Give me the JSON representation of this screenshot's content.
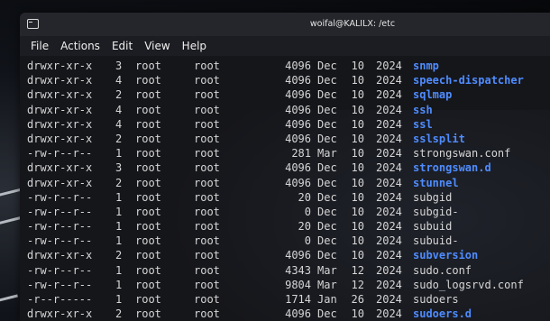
{
  "window": {
    "title": "woifal@KALILX: /etc",
    "icon": "terminal-icon"
  },
  "menu": [
    "File",
    "Actions",
    "Edit",
    "View",
    "Help"
  ],
  "colors": {
    "directory": "#4f8cff",
    "text": "#d6d6d6",
    "background": "#15161a"
  },
  "listing": [
    {
      "perm": "drwxr-xr-x",
      "links": "3",
      "owner": "root",
      "group": "root",
      "size": "4096",
      "month": "Dec",
      "day": "10",
      "year": "2024",
      "name": "snmp",
      "dir": true
    },
    {
      "perm": "drwxr-xr-x",
      "links": "4",
      "owner": "root",
      "group": "root",
      "size": "4096",
      "month": "Dec",
      "day": "10",
      "year": "2024",
      "name": "speech-dispatcher",
      "dir": true
    },
    {
      "perm": "drwxr-xr-x",
      "links": "2",
      "owner": "root",
      "group": "root",
      "size": "4096",
      "month": "Dec",
      "day": "10",
      "year": "2024",
      "name": "sqlmap",
      "dir": true
    },
    {
      "perm": "drwxr-xr-x",
      "links": "4",
      "owner": "root",
      "group": "root",
      "size": "4096",
      "month": "Dec",
      "day": "10",
      "year": "2024",
      "name": "ssh",
      "dir": true
    },
    {
      "perm": "drwxr-xr-x",
      "links": "4",
      "owner": "root",
      "group": "root",
      "size": "4096",
      "month": "Dec",
      "day": "10",
      "year": "2024",
      "name": "ssl",
      "dir": true
    },
    {
      "perm": "drwxr-xr-x",
      "links": "2",
      "owner": "root",
      "group": "root",
      "size": "4096",
      "month": "Dec",
      "day": "10",
      "year": "2024",
      "name": "sslsplit",
      "dir": true
    },
    {
      "perm": "-rw-r--r--",
      "links": "1",
      "owner": "root",
      "group": "root",
      "size": "281",
      "month": "Mar",
      "day": "10",
      "year": "2024",
      "name": "strongswan.conf",
      "dir": false
    },
    {
      "perm": "drwxr-xr-x",
      "links": "3",
      "owner": "root",
      "group": "root",
      "size": "4096",
      "month": "Dec",
      "day": "10",
      "year": "2024",
      "name": "strongswan.d",
      "dir": true
    },
    {
      "perm": "drwxr-xr-x",
      "links": "2",
      "owner": "root",
      "group": "root",
      "size": "4096",
      "month": "Dec",
      "day": "10",
      "year": "2024",
      "name": "stunnel",
      "dir": true
    },
    {
      "perm": "-rw-r--r--",
      "links": "1",
      "owner": "root",
      "group": "root",
      "size": "20",
      "month": "Dec",
      "day": "10",
      "year": "2024",
      "name": "subgid",
      "dir": false
    },
    {
      "perm": "-rw-r--r--",
      "links": "1",
      "owner": "root",
      "group": "root",
      "size": "0",
      "month": "Dec",
      "day": "10",
      "year": "2024",
      "name": "subgid-",
      "dir": false
    },
    {
      "perm": "-rw-r--r--",
      "links": "1",
      "owner": "root",
      "group": "root",
      "size": "20",
      "month": "Dec",
      "day": "10",
      "year": "2024",
      "name": "subuid",
      "dir": false
    },
    {
      "perm": "-rw-r--r--",
      "links": "1",
      "owner": "root",
      "group": "root",
      "size": "0",
      "month": "Dec",
      "day": "10",
      "year": "2024",
      "name": "subuid-",
      "dir": false
    },
    {
      "perm": "drwxr-xr-x",
      "links": "2",
      "owner": "root",
      "group": "root",
      "size": "4096",
      "month": "Dec",
      "day": "10",
      "year": "2024",
      "name": "subversion",
      "dir": true
    },
    {
      "perm": "-rw-r--r--",
      "links": "1",
      "owner": "root",
      "group": "root",
      "size": "4343",
      "month": "Mar",
      "day": "12",
      "year": "2024",
      "name": "sudo.conf",
      "dir": false
    },
    {
      "perm": "-rw-r--r--",
      "links": "1",
      "owner": "root",
      "group": "root",
      "size": "9804",
      "month": "Mar",
      "day": "12",
      "year": "2024",
      "name": "sudo_logsrvd.conf",
      "dir": false
    },
    {
      "perm": "-r--r-----",
      "links": "1",
      "owner": "root",
      "group": "root",
      "size": "1714",
      "month": "Jan",
      "day": "26",
      "year": "2024",
      "name": "sudoers",
      "dir": false
    },
    {
      "perm": "drwxr-xr-x",
      "links": "2",
      "owner": "root",
      "group": "root",
      "size": "4096",
      "month": "Dec",
      "day": "10",
      "year": "2024",
      "name": "sudoers.d",
      "dir": true
    }
  ]
}
